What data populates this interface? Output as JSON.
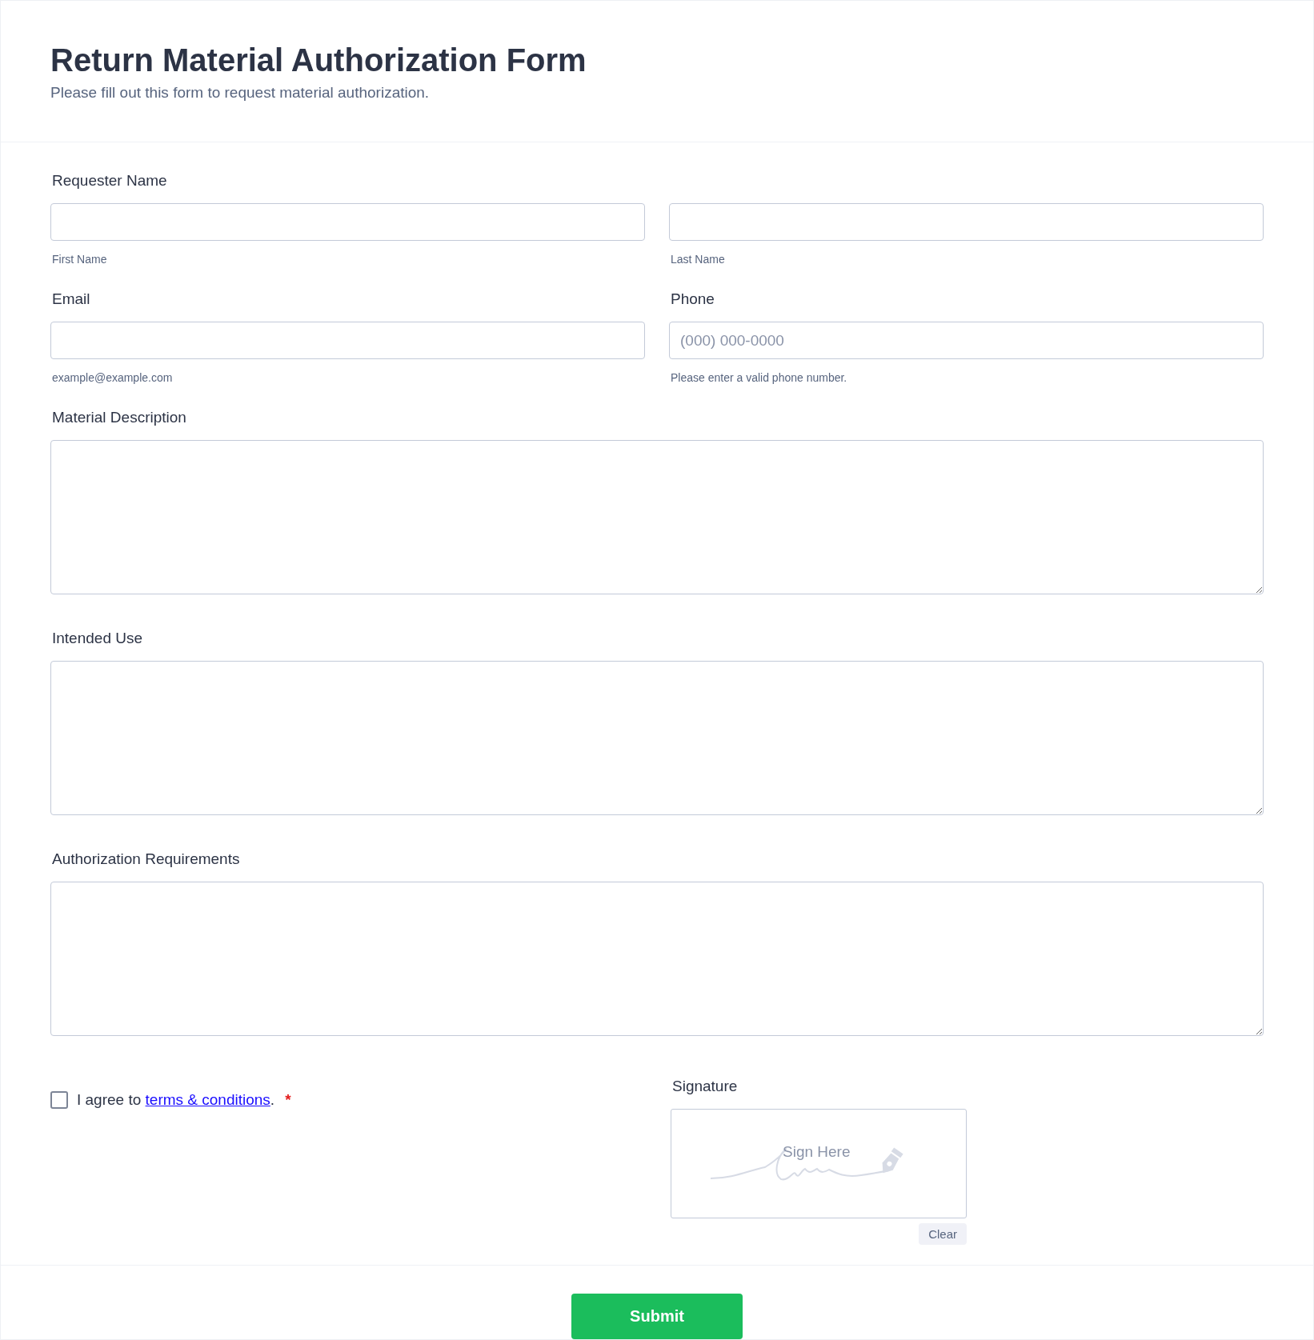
{
  "header": {
    "title": "Return Material Authorization Form",
    "subtitle": "Please fill out this form to request material authorization."
  },
  "requester_name": {
    "label": "Requester Name",
    "first": {
      "sublabel": "First Name"
    },
    "last": {
      "sublabel": "Last Name"
    }
  },
  "email": {
    "label": "Email",
    "sublabel": "example@example.com"
  },
  "phone": {
    "label": "Phone",
    "placeholder": "(000) 000-0000",
    "sublabel": "Please enter a valid phone number."
  },
  "text_areas": [
    {
      "label": "Material Description"
    },
    {
      "label": "Intended Use"
    },
    {
      "label": "Authorization Requirements"
    }
  ],
  "terms": {
    "checked": false,
    "prefix": "I agree to ",
    "link": "terms & conditions",
    "suffix": ".",
    "required_mark": "*"
  },
  "signature": {
    "label": "Signature",
    "hint": "Sign Here",
    "clear_button": "Clear"
  },
  "submit_button": "Submit"
}
